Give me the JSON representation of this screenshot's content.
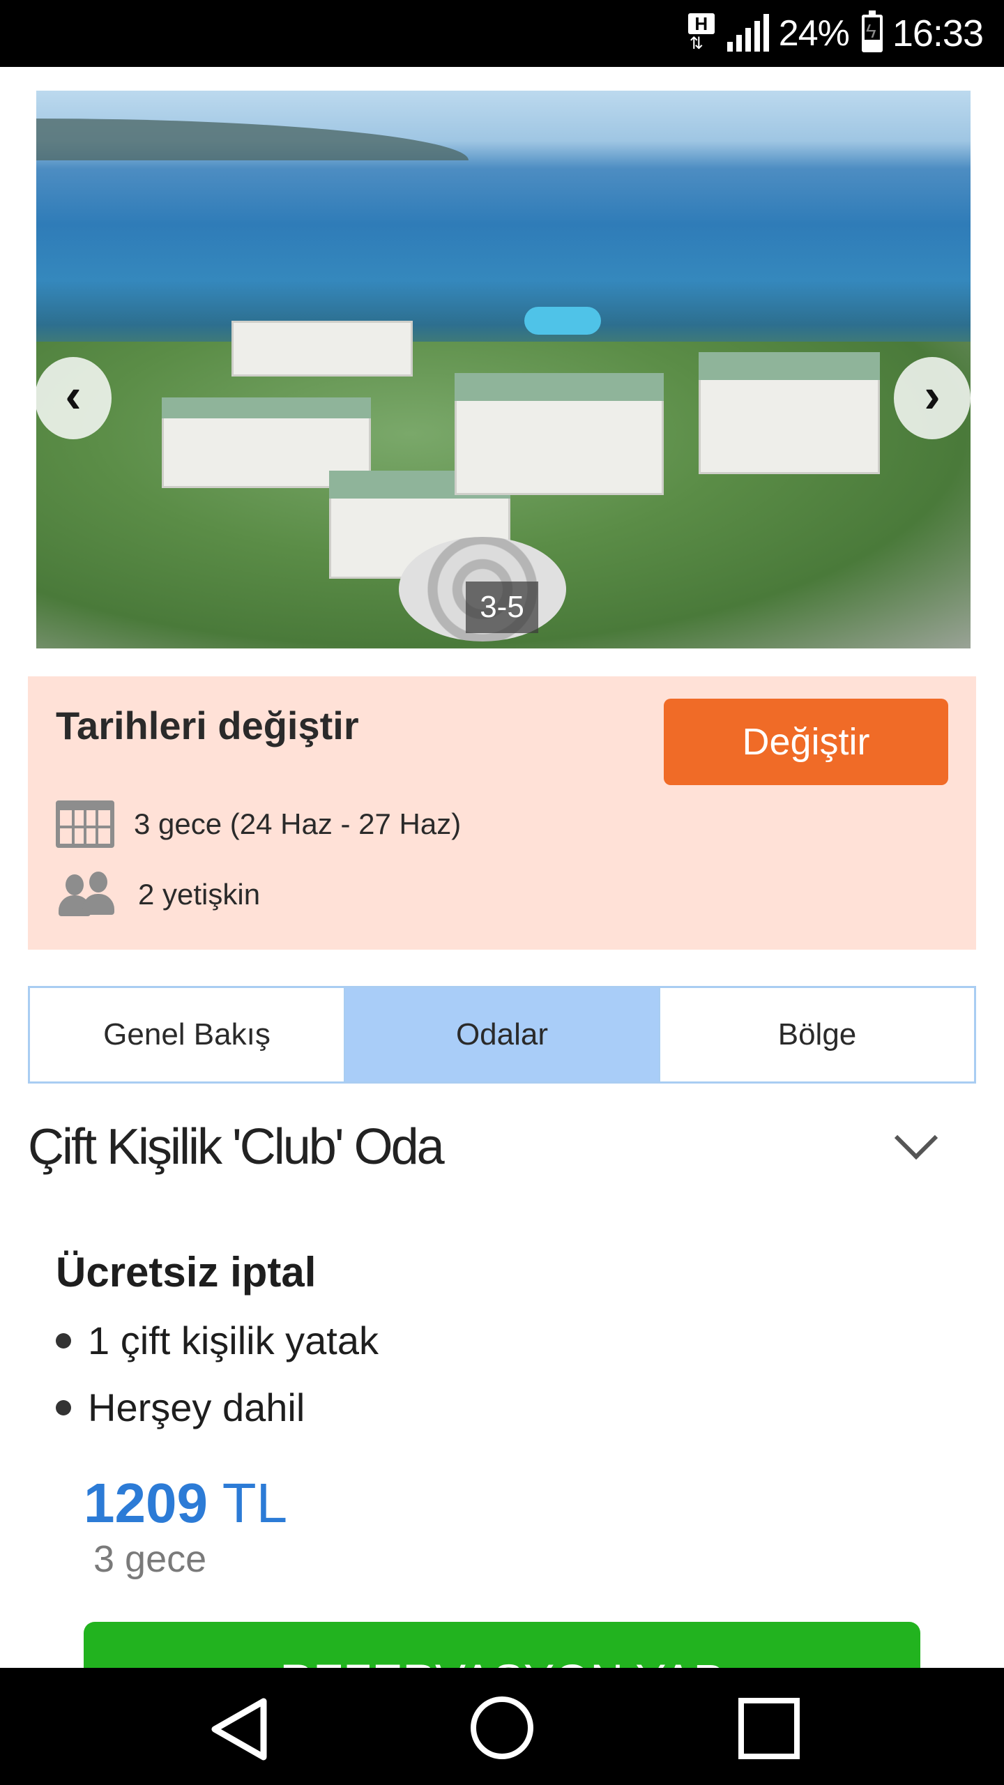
{
  "status_bar": {
    "network_badge": "H",
    "battery_percent": "24%",
    "time": "16:33",
    "icons": [
      "h-network-icon",
      "signal-icon",
      "battery-charging-icon"
    ]
  },
  "gallery": {
    "counter": "3-5",
    "prev_icon": "chevron-left-icon",
    "next_icon": "chevron-right-icon"
  },
  "dates": {
    "title": "Tarihleri değiştir",
    "change_button": "Değiştir",
    "nights_text": "3 gece (24 Haz - 27 Haz)",
    "guests_text": "2 yetişkin",
    "accent_color": "#f06b27",
    "panel_color": "#ffe1d7"
  },
  "tabs": [
    {
      "label": "Genel Bakış",
      "active": false
    },
    {
      "label": "Odalar",
      "active": true
    },
    {
      "label": "Bölge",
      "active": false
    }
  ],
  "room": {
    "title": "Çift Kişilik 'Club' Oda",
    "cancellation": "Ücretsiz iptal",
    "features": [
      "1 çift kişilik yatak",
      "Herşey dahil"
    ],
    "price_amount": "1209",
    "price_currency": "TL",
    "price_nights": "3 gece",
    "book_button": "REZERVASYON YAP",
    "price_color": "#2c7bd6",
    "book_color": "#22b31f"
  },
  "nav_bar": {
    "icons": [
      "back-icon",
      "home-icon",
      "recent-apps-icon"
    ]
  }
}
